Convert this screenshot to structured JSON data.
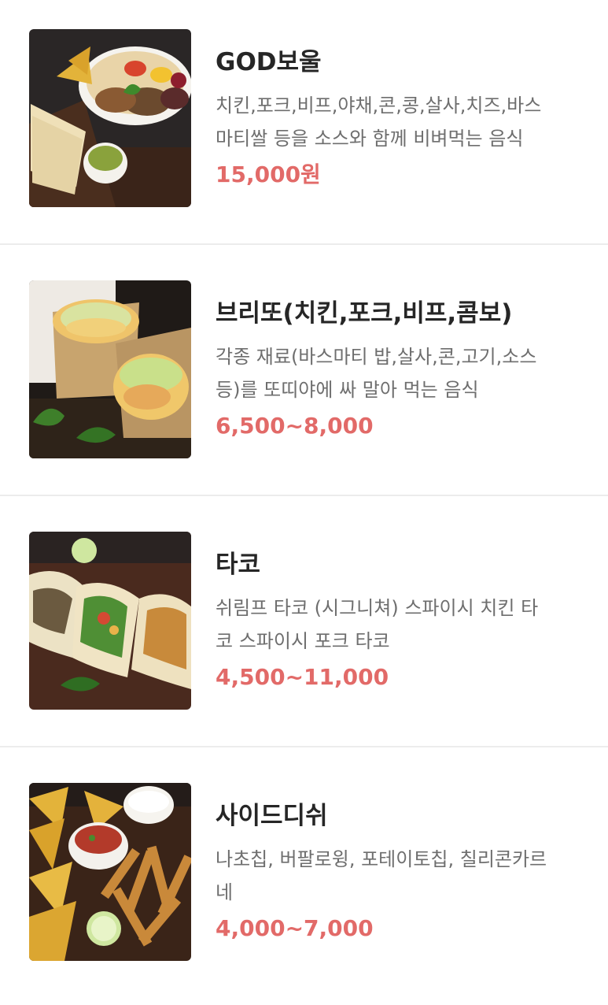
{
  "menu": {
    "items": [
      {
        "name": "GOD보울",
        "description_lines": [
          "치킨,포크,비프,야채,콘,콩,살사,치즈,바스",
          "마티쌀 등을 소스와 함께 비벼먹는 음식"
        ],
        "price": "15,000원"
      },
      {
        "name": "브리또(치킨,포크,비프,콤보)",
        "description_lines": [
          "각종 재료(바스마티 밥,살사,콘,고기,소스",
          "등)를 또띠야에 싸 말아 먹는 음식"
        ],
        "price": "6,500~8,000"
      },
      {
        "name": "타코",
        "description_lines": [
          "쉬림프 타코 (시그니쳐) 스파이시 치킨 타",
          "코 스파이시 포크 타코"
        ],
        "price": "4,500~11,000"
      },
      {
        "name": "사이드디쉬",
        "description_lines": [
          "나초칩, 버팔로윙, 포테이토칩, 칠리콘카르",
          "네"
        ],
        "price": "4,000~7,000"
      }
    ]
  },
  "colors": {
    "price": "#e26a68",
    "name": "#262626",
    "description": "#6e6e6e",
    "divider": "#ececec"
  },
  "images": [
    "bowl-photo",
    "burrito-photo",
    "taco-photo",
    "side-dish-photo"
  ]
}
